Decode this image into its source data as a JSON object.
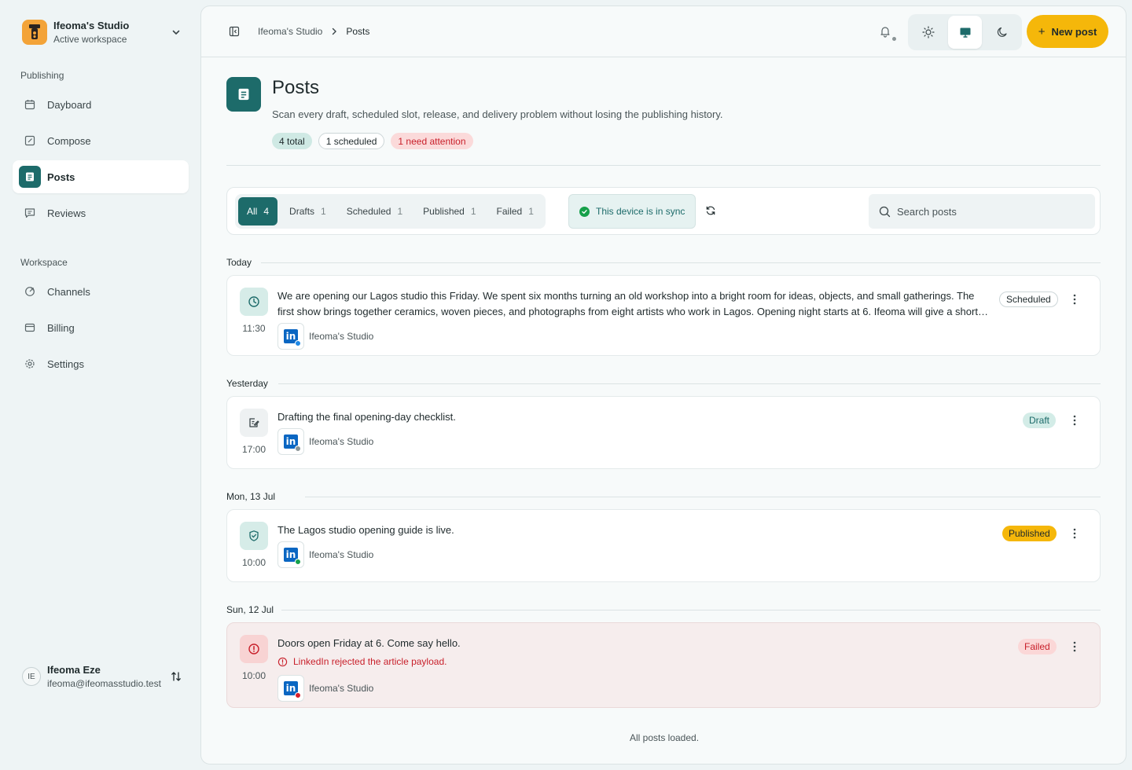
{
  "workspace": {
    "name": "Ifeoma's Studio",
    "subtitle": "Active workspace"
  },
  "sidebar": {
    "sections": [
      {
        "label": "Publishing"
      },
      {
        "label": "Workspace"
      }
    ],
    "items": [
      {
        "label": "Dayboard",
        "icon": "calendar-icon"
      },
      {
        "label": "Compose",
        "icon": "compose-icon"
      },
      {
        "label": "Posts",
        "icon": "posts-icon",
        "active": true
      },
      {
        "label": "Reviews",
        "icon": "reviews-icon"
      },
      {
        "label": "Channels",
        "icon": "channels-icon"
      },
      {
        "label": "Billing",
        "icon": "billing-icon"
      },
      {
        "label": "Settings",
        "icon": "gear-icon"
      }
    ]
  },
  "user": {
    "initials": "IE",
    "name": "Ifeoma Eze",
    "email": "ifeoma@ifeomasstudio.test"
  },
  "breadcrumb": {
    "parent": "Ifeoma's Studio",
    "current": "Posts"
  },
  "header": {
    "new_post_label": "New post"
  },
  "page": {
    "title": "Posts",
    "description": "Scan every draft, scheduled slot, release, and delivery problem without losing the publishing history.",
    "chips": {
      "total": "4 total",
      "scheduled": "1 scheduled",
      "attention": "1 need attention"
    }
  },
  "filters": {
    "tabs": [
      {
        "label": "All",
        "count": "4",
        "active": true
      },
      {
        "label": "Drafts",
        "count": "1"
      },
      {
        "label": "Scheduled",
        "count": "1"
      },
      {
        "label": "Published",
        "count": "1"
      },
      {
        "label": "Failed",
        "count": "1"
      }
    ],
    "sync_status": "This device is in sync",
    "search_placeholder": "Search posts"
  },
  "groups": [
    {
      "label": "Today"
    },
    {
      "label": "Yesterday"
    },
    {
      "label": "Mon, 13 Jul"
    },
    {
      "label": "Sun, 12 Jul"
    }
  ],
  "posts": [
    {
      "time": "11:30",
      "text_line1": "We are opening our Lagos studio this Friday. We spent six months turning an old workshop into a bright room for ideas, objects, and small gatherings. The",
      "text_line2": "first show brings together ceramics, woven pieces, and photographs from eight artists who work in Lagos. Opening night starts at 6. Ifeoma will give a short…",
      "channel": "Ifeoma's Studio",
      "status": "Scheduled",
      "icon": "clock-icon",
      "dot_color": "#1e88e5"
    },
    {
      "time": "17:00",
      "text_line1": "Drafting the final opening-day checklist.",
      "channel": "Ifeoma's Studio",
      "status": "Draft",
      "icon": "draft-icon",
      "dot_color": "#8a9496"
    },
    {
      "time": "10:00",
      "text_line1": "The Lagos studio opening guide is live.",
      "channel": "Ifeoma's Studio",
      "status": "Published",
      "icon": "shield-check-icon",
      "dot_color": "#16a04a"
    },
    {
      "time": "10:00",
      "text_line1": "Doors open Friday at 6. Come say hello.",
      "error": "LinkedIn rejected the article payload.",
      "channel": "Ifeoma's Studio",
      "status": "Failed",
      "icon": "alert-icon",
      "dot_color": "#d61f2c"
    }
  ],
  "footer": {
    "note": "All posts loaded."
  },
  "colors": {
    "accent": "#1d6b6a",
    "brand_yellow": "#f5b70a",
    "error": "#c81f2a"
  }
}
